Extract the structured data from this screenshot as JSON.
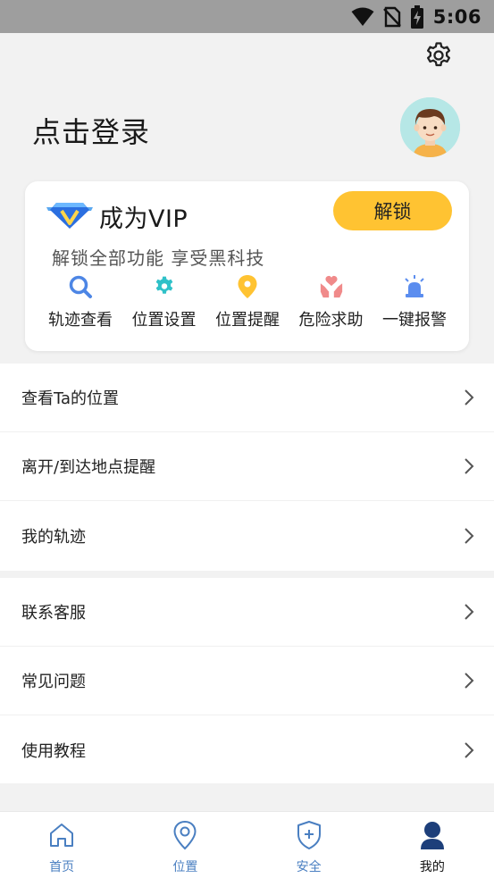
{
  "status_bar": {
    "time": "5:06"
  },
  "header": {
    "login_text": "点击登录"
  },
  "vip_card": {
    "title": "成为VIP",
    "subtitle": "解锁全部功能 享受黑科技",
    "unlock_label": "解锁",
    "features": [
      {
        "label": "轨迹查看",
        "icon": "search-icon",
        "color": "#4d86e5"
      },
      {
        "label": "位置设置",
        "icon": "gear-icon",
        "color": "#2fc1c8"
      },
      {
        "label": "位置提醒",
        "icon": "location-pin-icon",
        "color": "#ffc332"
      },
      {
        "label": "危险求助",
        "icon": "help-hands-icon",
        "color": "#f08a8a"
      },
      {
        "label": "一键报警",
        "icon": "alarm-light-icon",
        "color": "#5b8def"
      }
    ]
  },
  "menu": {
    "group1": [
      {
        "label": "查看Ta的位置"
      },
      {
        "label": "离开/到达地点提醒"
      },
      {
        "label": "我的轨迹"
      }
    ],
    "group2": [
      {
        "label": "联系客服"
      },
      {
        "label": "常见问题"
      },
      {
        "label": "使用教程"
      }
    ]
  },
  "tabbar": {
    "tabs": [
      {
        "label": "首页",
        "icon": "home-icon"
      },
      {
        "label": "位置",
        "icon": "location-icon"
      },
      {
        "label": "安全",
        "icon": "shield-plus-icon"
      },
      {
        "label": "我的",
        "icon": "person-icon",
        "active": true
      }
    ]
  },
  "colors": {
    "accent": "#ffc332",
    "tab_inactive": "#4a7fc1",
    "status_bar": "#9e9e9e"
  }
}
